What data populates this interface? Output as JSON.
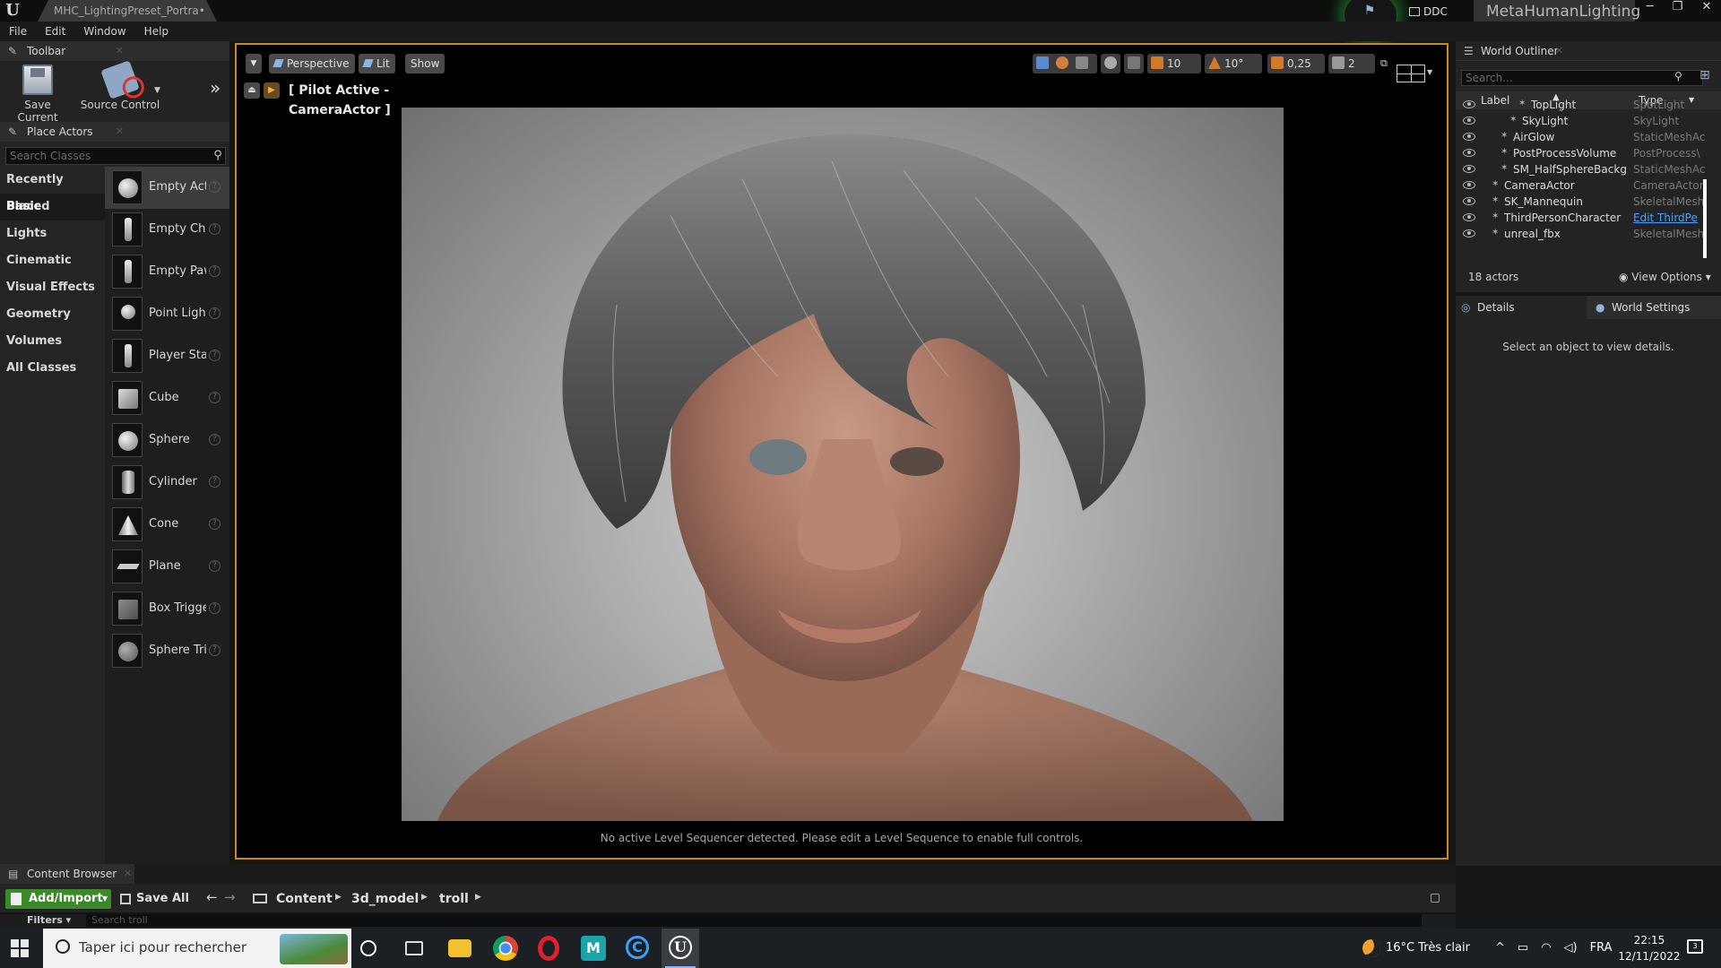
{
  "window": {
    "tab_title": "MHC_LightingPreset_Portra•",
    "ddc_label": "DDC",
    "project_name": "MetaHumanLighting"
  },
  "menu": [
    "File",
    "Edit",
    "Window",
    "Help"
  ],
  "toolbar_panel": {
    "title": "Toolbar",
    "save_current": "Save Current",
    "source_control": "Source Control"
  },
  "place_actors": {
    "title": "Place Actors",
    "search_placeholder": "Search Classes",
    "categories": [
      "Recently Placed",
      "Basic",
      "Lights",
      "Cinematic",
      "Visual Effects",
      "Geometry",
      "Volumes",
      "All Classes"
    ],
    "active_category": "Basic",
    "items": [
      "Empty Actor",
      "Empty Character",
      "Empty Pawn",
      "Point Light",
      "Player Start",
      "Cube",
      "Sphere",
      "Cylinder",
      "Cone",
      "Plane",
      "Box Trigger",
      "Sphere Trigger"
    ]
  },
  "viewport": {
    "perspective": "Perspective",
    "lit": "Lit",
    "show": "Show",
    "grid_snap": "10",
    "rotation_snap": "10°",
    "scale_snap": "0,25",
    "camera_speed": "2",
    "pilot_label": "[ Pilot Active - CameraActor ]",
    "message": "No active Level Sequencer detected. Please edit a Level Sequence to enable full controls."
  },
  "outliner": {
    "title": "World Outliner",
    "search_placeholder": "Search...",
    "col_label": "Label",
    "col_type": "Type",
    "rows": [
      {
        "label": "TopLight",
        "type": "SpotLight",
        "indent": 3
      },
      {
        "label": "SkyLight",
        "type": "SkyLight",
        "indent": 2
      },
      {
        "label": "AirGlow",
        "type": "StaticMeshAc",
        "indent": 1
      },
      {
        "label": "PostProcessVolume",
        "type": "PostProcess\\",
        "indent": 1
      },
      {
        "label": "SM_HalfSphereBackg",
        "type": "StaticMeshAc",
        "indent": 1
      },
      {
        "label": "CameraActor",
        "type": "CameraActor",
        "indent": 0
      },
      {
        "label": "SK_Mannequin",
        "type": "SkeletalMesh",
        "indent": 0
      },
      {
        "label": "ThirdPersonCharacter",
        "type": "Edit ThirdPe",
        "indent": 0,
        "link": true
      },
      {
        "label": "unreal_fbx",
        "type": "SkeletalMesh",
        "indent": 0
      }
    ],
    "actor_count": "18 actors",
    "view_options": "View Options"
  },
  "details": {
    "tab_details": "Details",
    "tab_world": "World Settings",
    "empty_message": "Select an object to view details."
  },
  "content_browser": {
    "title": "Content Browser",
    "add_import": "Add/Import",
    "save_all": "Save All",
    "path": [
      "Content",
      "3d_model",
      "troll"
    ],
    "filters": "Filters",
    "search_placeholder": "Search troll"
  },
  "taskbar": {
    "search_text": "Taper ici pour rechercher",
    "weather": "16°C  Très clair",
    "language": "FRA",
    "time": "22:15",
    "date": "12/11/2022"
  }
}
